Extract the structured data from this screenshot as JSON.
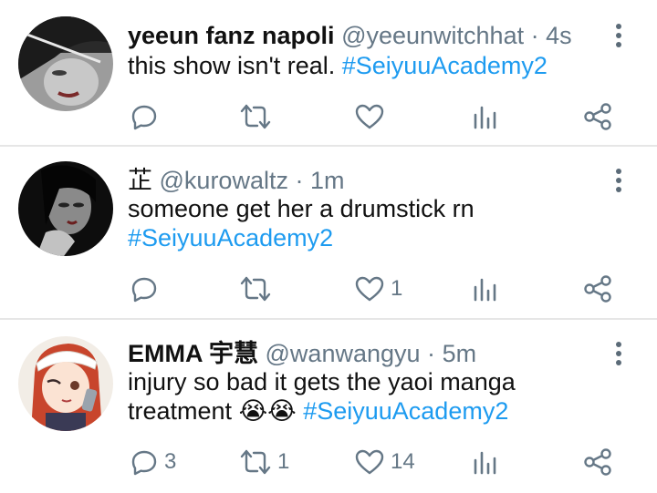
{
  "tweets": [
    {
      "display_name": "yeeun fanz napoli",
      "handle": "@yeeunwitchhat",
      "separator": "·",
      "time": "4s",
      "text_plain": "this show isn't real.",
      "hashtag": "#SeiyuuAcademy2",
      "reply_count": "",
      "retweet_count": "",
      "like_count": ""
    },
    {
      "display_name": "芷",
      "handle": "@kurowaltz",
      "separator": "·",
      "time": "1m",
      "text_plain": "someone get her a drumstick rn",
      "hashtag": "#SeiyuuAcademy2",
      "reply_count": "",
      "retweet_count": "",
      "like_count": "1"
    },
    {
      "display_name": "EMMA 宇慧",
      "handle": "@wanwangyu",
      "separator": "·",
      "time": "5m",
      "text_plain": "injury so bad it gets the yaoi manga treatment",
      "emoji": "😭😭",
      "hashtag": "#SeiyuuAcademy2",
      "reply_count": "3",
      "retweet_count": "1",
      "like_count": "14"
    }
  ],
  "colors": {
    "hashtag": "#1d9bf0",
    "meta_gray": "#657786",
    "divider": "#e6e6e6"
  },
  "icons": [
    "reply-icon",
    "retweet-icon",
    "like-icon",
    "analytics-icon",
    "share-icon",
    "more-icon"
  ]
}
